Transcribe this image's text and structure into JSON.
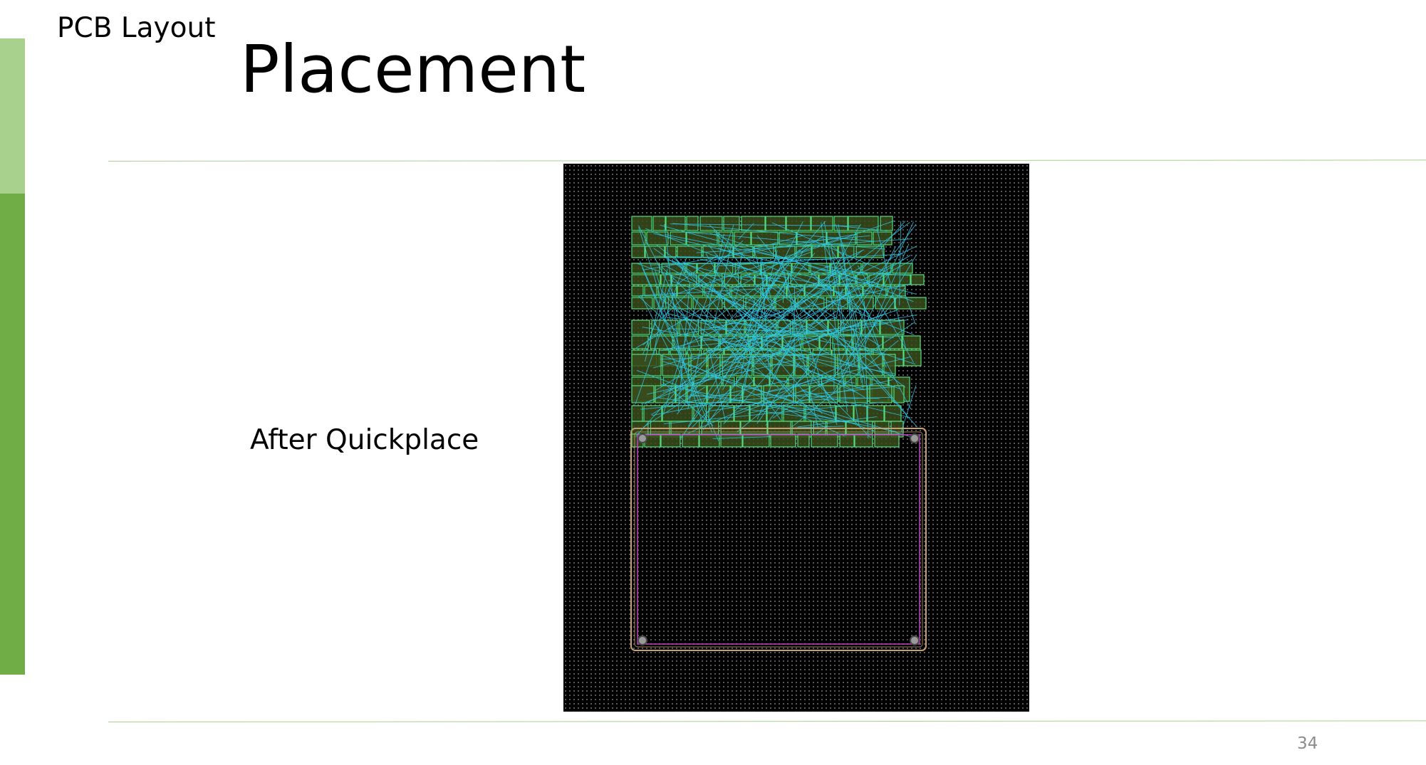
{
  "slide": {
    "section": "PCB Layout",
    "title": "Placement",
    "caption": "After Quickplace",
    "page_number": "34"
  },
  "figure": {
    "kind": "pcb-layout-screenshot",
    "colors": {
      "background": "#000000",
      "grid_dot": "#6a6a6a",
      "component_fill": "#3a4d1c",
      "component_outline": "#52e07a",
      "ratsnest": "#2ec7e8",
      "board_outline": "#c8a070",
      "keepout": "#c040c0",
      "mount_hole": "#9a9a9a"
    }
  },
  "theme": {
    "accent_light": "#a9d18e",
    "accent_dark": "#70ad47",
    "rule": "#a9d18e",
    "page_number": "#8c8c8c"
  }
}
